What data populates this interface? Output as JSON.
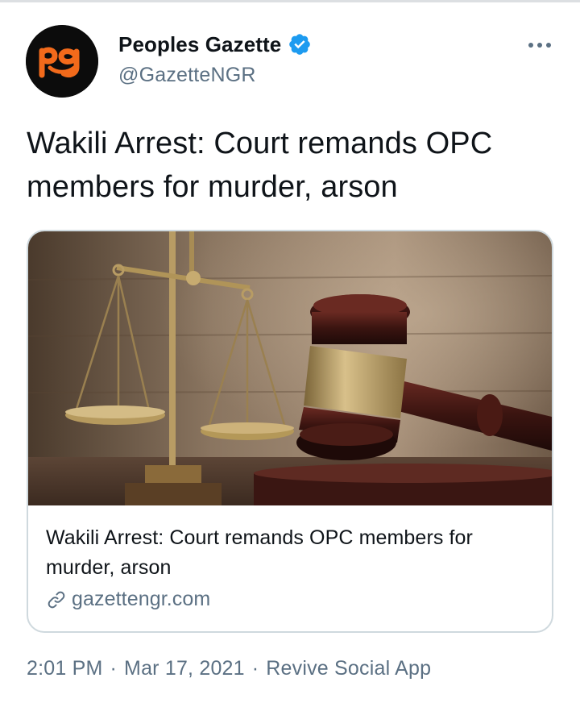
{
  "tweet": {
    "author": {
      "display_name": "Peoples Gazette",
      "handle": "@GazetteNGR",
      "verified": true,
      "avatar_text": "pg",
      "avatar_color": "#f26a1b"
    },
    "text": "Wakili Arrest: Court remands OPC members for murder, arson",
    "card": {
      "image": "judge-gavel-and-scales-photo",
      "title": "Wakili Arrest: Court remands OPC members for murder, arson",
      "domain": "gazettengr.com"
    },
    "meta": {
      "time": "2:01 PM",
      "separator": "·",
      "date": "Mar 17, 2021",
      "source": "Revive Social App"
    }
  },
  "colors": {
    "verified_blue": "#1d9bf0",
    "secondary_text": "#5b7083",
    "border": "#cfd9de"
  }
}
